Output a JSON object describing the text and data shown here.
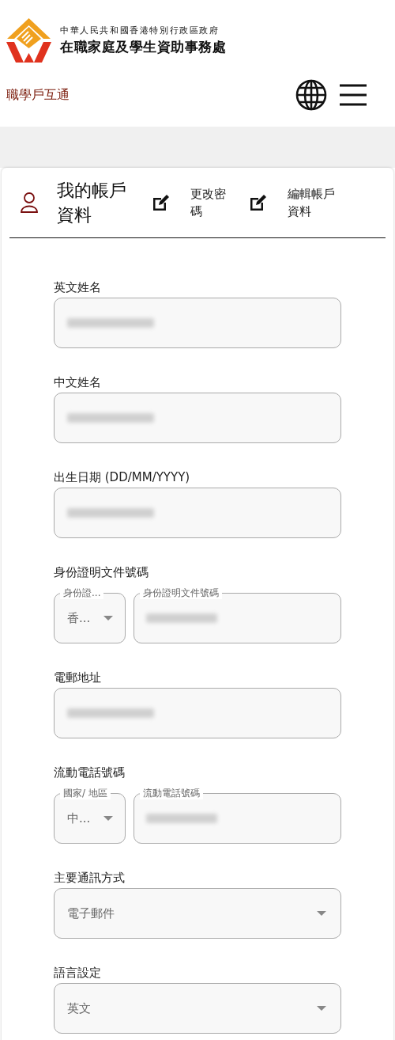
{
  "header": {
    "org_line_1": "中華人民共和國香港特別行政區政府",
    "org_line_2": "在職家庭及學生資助事務處",
    "site_name": "職學戶互通"
  },
  "account": {
    "title": "我的帳戶資料",
    "actions": [
      {
        "label": "更改密碼"
      },
      {
        "label": "編輯帳戶資料"
      }
    ]
  },
  "fields": [
    {
      "kind": "text",
      "label": "英文姓名",
      "redacted": true
    },
    {
      "kind": "text",
      "label": "中文姓名",
      "redacted": true
    },
    {
      "kind": "text",
      "label": "出生日期 (DD/MM/YYYY)",
      "redacted": true
    },
    {
      "kind": "pair",
      "label": "身份證明文件號碼",
      "select_label": "身份證...",
      "select_value": "香...",
      "input_label": "身份證明文件號碼",
      "redacted": true
    },
    {
      "kind": "text",
      "label": "電郵地址",
      "redacted": true
    },
    {
      "kind": "pair",
      "label": "流動電話號碼",
      "select_label": "國家/ 地區",
      "select_value": "中...",
      "input_label": "流動電話號碼",
      "redacted": true
    },
    {
      "kind": "select",
      "label": "主要通訊方式",
      "value": "電子郵件"
    },
    {
      "kind": "select",
      "label": "語言設定",
      "value": "英文"
    }
  ]
}
